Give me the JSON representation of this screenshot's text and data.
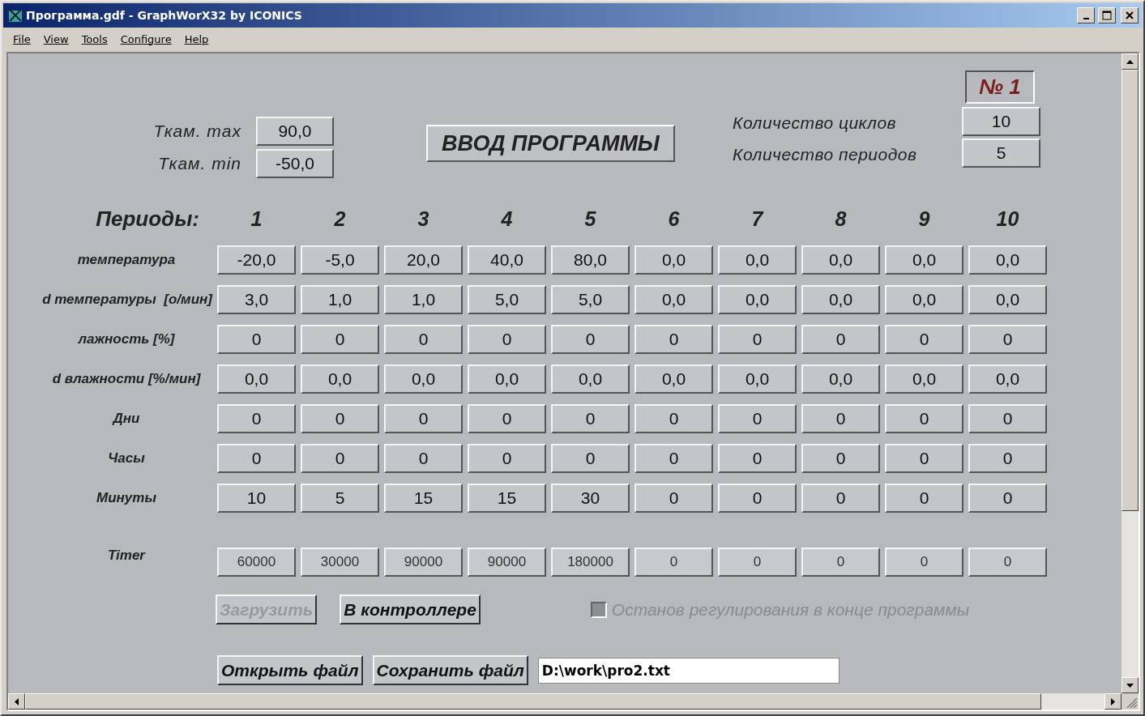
{
  "window": {
    "title": "Программа.gdf - GraphWorX32 by ICONICS"
  },
  "menu": [
    "File",
    "View",
    "Tools",
    "Configure",
    "Help"
  ],
  "limits": [
    {
      "label": "Ткам. max",
      "value": "90,0"
    },
    {
      "label": "Ткам. min",
      "value": "-50,0"
    }
  ],
  "heading": "ВВОД ПРОГРАММЫ",
  "program_number": "№ 1",
  "counts": [
    {
      "label": "Количество циклов",
      "value": "10"
    },
    {
      "label": "Количество периодов",
      "value": "5"
    }
  ],
  "periods": {
    "label": "Периоды:",
    "numbers": [
      "1",
      "2",
      "3",
      "4",
      "5",
      "6",
      "7",
      "8",
      "9",
      "10"
    ]
  },
  "rows": [
    {
      "label": "температура",
      "kind": "input",
      "values": [
        "-20,0",
        "-5,0",
        "20,0",
        "40,0",
        "80,0",
        "0,0",
        "0,0",
        "0,0",
        "0,0",
        "0,0"
      ]
    },
    {
      "label": "d температуры  [о/мин]",
      "kind": "input",
      "values": [
        "3,0",
        "1,0",
        "1,0",
        "5,0",
        "5,0",
        "0,0",
        "0,0",
        "0,0",
        "0,0",
        "0,0"
      ]
    },
    {
      "label": "лажность [%]",
      "kind": "input",
      "values": [
        "0",
        "0",
        "0",
        "0",
        "0",
        "0",
        "0",
        "0",
        "0",
        "0"
      ]
    },
    {
      "label": "d влажности [%/мин]",
      "kind": "input",
      "values": [
        "0,0",
        "0,0",
        "0,0",
        "0,0",
        "0,0",
        "0,0",
        "0,0",
        "0,0",
        "0,0",
        "0,0"
      ]
    },
    {
      "label": "Дни",
      "kind": "input",
      "values": [
        "0",
        "0",
        "0",
        "0",
        "0",
        "0",
        "0",
        "0",
        "0",
        "0"
      ]
    },
    {
      "label": "Часы",
      "kind": "input",
      "values": [
        "0",
        "0",
        "0",
        "0",
        "0",
        "0",
        "0",
        "0",
        "0",
        "0"
      ]
    },
    {
      "label": "Минуты",
      "kind": "input",
      "values": [
        "10",
        "5",
        "15",
        "15",
        "30",
        "0",
        "0",
        "0",
        "0",
        "0"
      ]
    },
    {
      "label": "Timer",
      "kind": "readout",
      "values": [
        "60000",
        "30000",
        "90000",
        "90000",
        "180000",
        "0",
        "0",
        "0",
        "0",
        "0"
      ]
    }
  ],
  "load_button": {
    "label": "Загрузить",
    "disabled": true
  },
  "controller_button": {
    "label": "В контроллере",
    "disabled": false
  },
  "stop_checkbox": {
    "label": "Останов регулирования в конце программы",
    "checked": false,
    "disabled": true
  },
  "open_button": {
    "label": "Открыть файл"
  },
  "save_button": {
    "label": "Сохранить файл"
  },
  "file_path": {
    "value": "D:\\work\\pro2.txt"
  }
}
